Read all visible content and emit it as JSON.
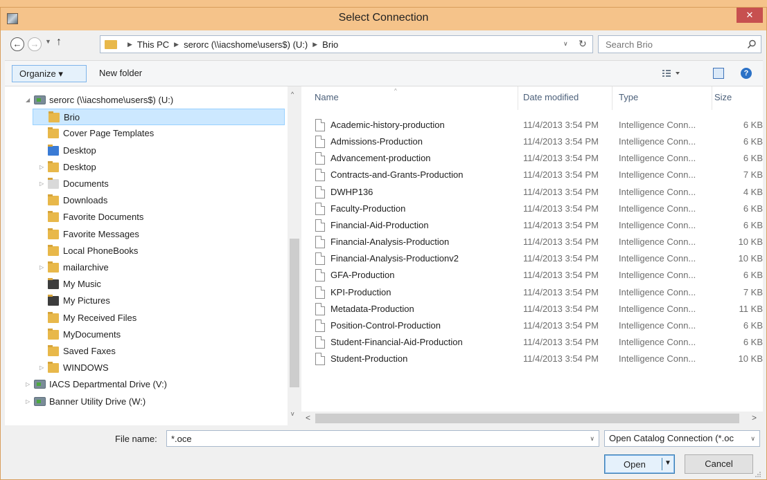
{
  "window": {
    "title": "Select Connection",
    "close_symbol": "✕"
  },
  "navigation": {
    "back_symbol": "←",
    "forward_symbol": "→",
    "recent_symbol": "▼",
    "up_symbol": "↑",
    "breadcrumbs": [
      "This PC",
      "serorc (\\\\iacshome\\users$) (U:)",
      "Brio"
    ],
    "crumb_separator": "▶",
    "dropdown_symbol": "∨",
    "refresh_symbol": "↻",
    "search_placeholder": "Search Brio"
  },
  "toolbar": {
    "organize_label": "Organize ▾",
    "new_folder_label": "New folder",
    "help_symbol": "?"
  },
  "tree": {
    "items": [
      {
        "label": "serorc (\\\\iacshome\\users$) (U:)",
        "icon": "network-drive-icon",
        "expander": "◢",
        "level": 0
      },
      {
        "label": "Brio",
        "icon": "folder-icon",
        "expander": "",
        "level": 1,
        "selected": true
      },
      {
        "label": "Cover Page Templates",
        "icon": "folder-icon",
        "expander": "",
        "level": 1
      },
      {
        "label": "Desktop",
        "icon": "desktop-folder-icon",
        "expander": "",
        "level": 1
      },
      {
        "label": "Desktop",
        "icon": "folder-icon",
        "expander": "▷",
        "level": 1
      },
      {
        "label": "Documents",
        "icon": "documents-folder-icon",
        "expander": "▷",
        "level": 1
      },
      {
        "label": "Downloads",
        "icon": "folder-icon",
        "expander": "",
        "level": 1
      },
      {
        "label": "Favorite Documents",
        "icon": "folder-icon",
        "expander": "",
        "level": 1
      },
      {
        "label": "Favorite Messages",
        "icon": "folder-icon",
        "expander": "",
        "level": 1
      },
      {
        "label": "Local PhoneBooks",
        "icon": "folder-icon",
        "expander": "",
        "level": 1
      },
      {
        "label": "mailarchive",
        "icon": "folder-icon",
        "expander": "▷",
        "level": 1
      },
      {
        "label": "My Music",
        "icon": "music-folder-icon",
        "expander": "",
        "level": 1
      },
      {
        "label": "My Pictures",
        "icon": "pictures-folder-icon",
        "expander": "",
        "level": 1
      },
      {
        "label": "My Received Files",
        "icon": "folder-icon",
        "expander": "",
        "level": 1
      },
      {
        "label": "MyDocuments",
        "icon": "folder-icon",
        "expander": "",
        "level": 1
      },
      {
        "label": "Saved Faxes",
        "icon": "folder-icon",
        "expander": "",
        "level": 1
      },
      {
        "label": "WINDOWS",
        "icon": "folder-icon",
        "expander": "▷",
        "level": 1
      },
      {
        "label": "IACS Departmental Drive (V:)",
        "icon": "network-drive-icon",
        "expander": "▷",
        "level": 0
      },
      {
        "label": "Banner Utility Drive (W:)",
        "icon": "network-drive-icon",
        "expander": "▷",
        "level": 0
      }
    ]
  },
  "scroll": {
    "up": "^",
    "down": "v",
    "left": "<",
    "right": ">"
  },
  "files": {
    "columns": {
      "name": "Name",
      "date": "Date modified",
      "type": "Type",
      "size": "Size",
      "sort_symbol": "^"
    },
    "rows": [
      {
        "name": "Academic-history-production",
        "date": "11/4/2013 3:54 PM",
        "type": "Intelligence Conn...",
        "size": "6 KB"
      },
      {
        "name": "Admissions-Production",
        "date": "11/4/2013 3:54 PM",
        "type": "Intelligence Conn...",
        "size": "6 KB"
      },
      {
        "name": "Advancement-production",
        "date": "11/4/2013 3:54 PM",
        "type": "Intelligence Conn...",
        "size": "6 KB"
      },
      {
        "name": "Contracts-and-Grants-Production",
        "date": "11/4/2013 3:54 PM",
        "type": "Intelligence Conn...",
        "size": "7 KB"
      },
      {
        "name": "DWHP136",
        "date": "11/4/2013 3:54 PM",
        "type": "Intelligence Conn...",
        "size": "4 KB"
      },
      {
        "name": "Faculty-Production",
        "date": "11/4/2013 3:54 PM",
        "type": "Intelligence Conn...",
        "size": "6 KB"
      },
      {
        "name": "Financial-Aid-Production",
        "date": "11/4/2013 3:54 PM",
        "type": "Intelligence Conn...",
        "size": "6 KB"
      },
      {
        "name": "Financial-Analysis-Production",
        "date": "11/4/2013 3:54 PM",
        "type": "Intelligence Conn...",
        "size": "10 KB"
      },
      {
        "name": "Financial-Analysis-Productionv2",
        "date": "11/4/2013 3:54 PM",
        "type": "Intelligence Conn...",
        "size": "10 KB"
      },
      {
        "name": "GFA-Production",
        "date": "11/4/2013 3:54 PM",
        "type": "Intelligence Conn...",
        "size": "6 KB"
      },
      {
        "name": "KPI-Production",
        "date": "11/4/2013 3:54 PM",
        "type": "Intelligence Conn...",
        "size": "7 KB"
      },
      {
        "name": "Metadata-Production",
        "date": "11/4/2013 3:54 PM",
        "type": "Intelligence Conn...",
        "size": "11 KB"
      },
      {
        "name": "Position-Control-Production",
        "date": "11/4/2013 3:54 PM",
        "type": "Intelligence Conn...",
        "size": "6 KB"
      },
      {
        "name": "Student-Financial-Aid-Production",
        "date": "11/4/2013 3:54 PM",
        "type": "Intelligence Conn...",
        "size": "6 KB"
      },
      {
        "name": "Student-Production",
        "date": "11/4/2013 3:54 PM",
        "type": "Intelligence Conn...",
        "size": "10 KB"
      }
    ]
  },
  "footer": {
    "filename_label": "File name:",
    "filename_value": "*.oce",
    "filetype_value": "Open Catalog Connection (*.oc",
    "open_label": "Open",
    "open_split_symbol": "▼",
    "cancel_label": "Cancel"
  },
  "colors": {
    "titlebar": "#f5c38a",
    "selected_row": "#cce8ff",
    "close_button": "#c7504f",
    "column_header_text": "#4c607a"
  }
}
